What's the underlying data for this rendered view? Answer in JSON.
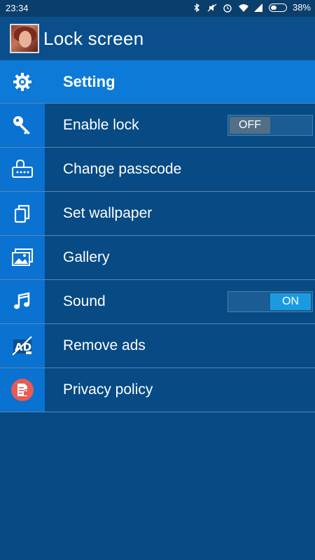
{
  "status_bar": {
    "time": "23:34",
    "battery": "38%",
    "icons": [
      "bluetooth-icon",
      "mute-icon",
      "alarm-icon",
      "wifi-icon",
      "signal-icon",
      "battery-icon"
    ]
  },
  "app_bar": {
    "title": "Lock screen"
  },
  "menu": {
    "header": {
      "label": "Setting",
      "icon": "gear-icon"
    },
    "items": [
      {
        "label": "Enable lock",
        "icon": "key-icon",
        "toggle": "OFF"
      },
      {
        "label": "Change passcode",
        "icon": "passcode-lock-icon"
      },
      {
        "label": "Set wallpaper",
        "icon": "copy-icon"
      },
      {
        "label": "Gallery",
        "icon": "gallery-icon"
      },
      {
        "label": "Sound",
        "icon": "music-note-icon",
        "toggle": "ON"
      },
      {
        "label": "Remove ads",
        "icon": "no-ads-icon"
      },
      {
        "label": "Privacy policy",
        "icon": "privacy-document-icon"
      }
    ]
  },
  "colors": {
    "background": "#064a84",
    "header": "#0c7ad6",
    "icon_cell": "#0a72d1",
    "toggle_on": "#1a9be0"
  }
}
